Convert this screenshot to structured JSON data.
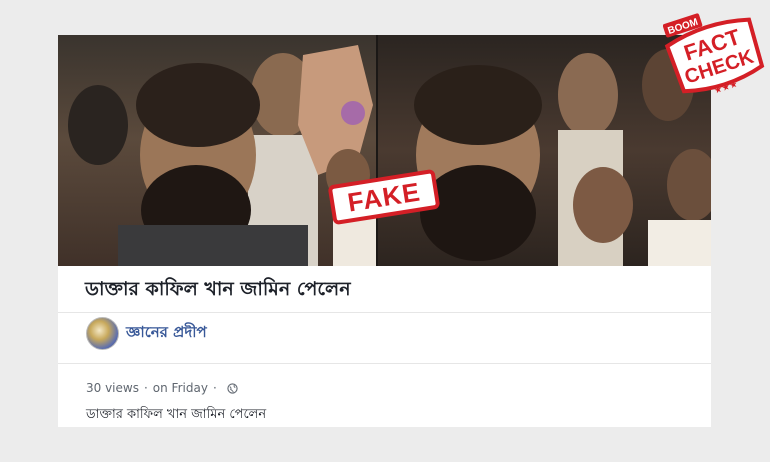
{
  "post": {
    "title": "ডাক্তার কাফিল খান জামিন পেলেন",
    "page_name": "জ্ঞানের প্রদীপ",
    "views": "30 views",
    "time": "on Friday",
    "separator": "·",
    "privacy_icon": "globe-icon",
    "description": "ডাক্তার কাফিল খান জামিন পেলেন"
  },
  "overlay": {
    "fake_stamp": "FAKE"
  },
  "badge": {
    "brand": "BOOM",
    "line1": "FACT",
    "line2": "CHECK",
    "color": "#d41f26"
  }
}
